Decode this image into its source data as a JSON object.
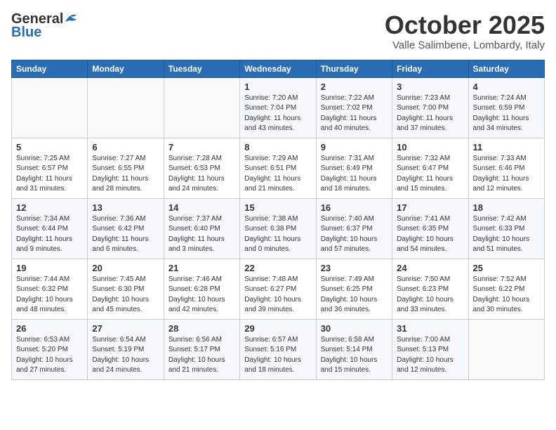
{
  "header": {
    "logo_general": "General",
    "logo_blue": "Blue",
    "title": "October 2025",
    "location": "Valle Salimbene, Lombardy, Italy"
  },
  "days_of_week": [
    "Sunday",
    "Monday",
    "Tuesday",
    "Wednesday",
    "Thursday",
    "Friday",
    "Saturday"
  ],
  "weeks": [
    [
      {
        "day": "",
        "content": ""
      },
      {
        "day": "",
        "content": ""
      },
      {
        "day": "",
        "content": ""
      },
      {
        "day": "1",
        "content": "Sunrise: 7:20 AM\nSunset: 7:04 PM\nDaylight: 11 hours\nand 43 minutes."
      },
      {
        "day": "2",
        "content": "Sunrise: 7:22 AM\nSunset: 7:02 PM\nDaylight: 11 hours\nand 40 minutes."
      },
      {
        "day": "3",
        "content": "Sunrise: 7:23 AM\nSunset: 7:00 PM\nDaylight: 11 hours\nand 37 minutes."
      },
      {
        "day": "4",
        "content": "Sunrise: 7:24 AM\nSunset: 6:59 PM\nDaylight: 11 hours\nand 34 minutes."
      }
    ],
    [
      {
        "day": "5",
        "content": "Sunrise: 7:25 AM\nSunset: 6:57 PM\nDaylight: 11 hours\nand 31 minutes."
      },
      {
        "day": "6",
        "content": "Sunrise: 7:27 AM\nSunset: 6:55 PM\nDaylight: 11 hours\nand 28 minutes."
      },
      {
        "day": "7",
        "content": "Sunrise: 7:28 AM\nSunset: 6:53 PM\nDaylight: 11 hours\nand 24 minutes."
      },
      {
        "day": "8",
        "content": "Sunrise: 7:29 AM\nSunset: 6:51 PM\nDaylight: 11 hours\nand 21 minutes."
      },
      {
        "day": "9",
        "content": "Sunrise: 7:31 AM\nSunset: 6:49 PM\nDaylight: 11 hours\nand 18 minutes."
      },
      {
        "day": "10",
        "content": "Sunrise: 7:32 AM\nSunset: 6:47 PM\nDaylight: 11 hours\nand 15 minutes."
      },
      {
        "day": "11",
        "content": "Sunrise: 7:33 AM\nSunset: 6:46 PM\nDaylight: 11 hours\nand 12 minutes."
      }
    ],
    [
      {
        "day": "12",
        "content": "Sunrise: 7:34 AM\nSunset: 6:44 PM\nDaylight: 11 hours\nand 9 minutes."
      },
      {
        "day": "13",
        "content": "Sunrise: 7:36 AM\nSunset: 6:42 PM\nDaylight: 11 hours\nand 6 minutes."
      },
      {
        "day": "14",
        "content": "Sunrise: 7:37 AM\nSunset: 6:40 PM\nDaylight: 11 hours\nand 3 minutes."
      },
      {
        "day": "15",
        "content": "Sunrise: 7:38 AM\nSunset: 6:38 PM\nDaylight: 11 hours\nand 0 minutes."
      },
      {
        "day": "16",
        "content": "Sunrise: 7:40 AM\nSunset: 6:37 PM\nDaylight: 10 hours\nand 57 minutes."
      },
      {
        "day": "17",
        "content": "Sunrise: 7:41 AM\nSunset: 6:35 PM\nDaylight: 10 hours\nand 54 minutes."
      },
      {
        "day": "18",
        "content": "Sunrise: 7:42 AM\nSunset: 6:33 PM\nDaylight: 10 hours\nand 51 minutes."
      }
    ],
    [
      {
        "day": "19",
        "content": "Sunrise: 7:44 AM\nSunset: 6:32 PM\nDaylight: 10 hours\nand 48 minutes."
      },
      {
        "day": "20",
        "content": "Sunrise: 7:45 AM\nSunset: 6:30 PM\nDaylight: 10 hours\nand 45 minutes."
      },
      {
        "day": "21",
        "content": "Sunrise: 7:46 AM\nSunset: 6:28 PM\nDaylight: 10 hours\nand 42 minutes."
      },
      {
        "day": "22",
        "content": "Sunrise: 7:48 AM\nSunset: 6:27 PM\nDaylight: 10 hours\nand 39 minutes."
      },
      {
        "day": "23",
        "content": "Sunrise: 7:49 AM\nSunset: 6:25 PM\nDaylight: 10 hours\nand 36 minutes."
      },
      {
        "day": "24",
        "content": "Sunrise: 7:50 AM\nSunset: 6:23 PM\nDaylight: 10 hours\nand 33 minutes."
      },
      {
        "day": "25",
        "content": "Sunrise: 7:52 AM\nSunset: 6:22 PM\nDaylight: 10 hours\nand 30 minutes."
      }
    ],
    [
      {
        "day": "26",
        "content": "Sunrise: 6:53 AM\nSunset: 5:20 PM\nDaylight: 10 hours\nand 27 minutes."
      },
      {
        "day": "27",
        "content": "Sunrise: 6:54 AM\nSunset: 5:19 PM\nDaylight: 10 hours\nand 24 minutes."
      },
      {
        "day": "28",
        "content": "Sunrise: 6:56 AM\nSunset: 5:17 PM\nDaylight: 10 hours\nand 21 minutes."
      },
      {
        "day": "29",
        "content": "Sunrise: 6:57 AM\nSunset: 5:16 PM\nDaylight: 10 hours\nand 18 minutes."
      },
      {
        "day": "30",
        "content": "Sunrise: 6:58 AM\nSunset: 5:14 PM\nDaylight: 10 hours\nand 15 minutes."
      },
      {
        "day": "31",
        "content": "Sunrise: 7:00 AM\nSunset: 5:13 PM\nDaylight: 10 hours\nand 12 minutes."
      },
      {
        "day": "",
        "content": ""
      }
    ]
  ]
}
